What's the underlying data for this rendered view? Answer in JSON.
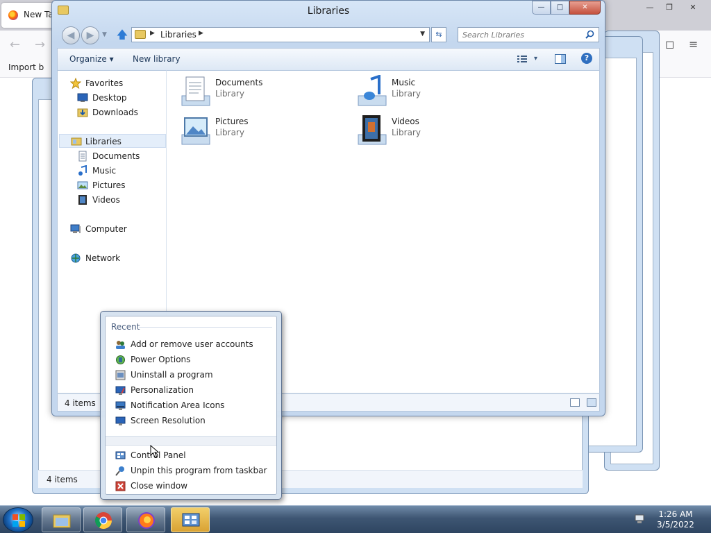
{
  "firefox": {
    "tab_label": "New Tab",
    "bookmark_import": "Import b",
    "back_glyph": "←",
    "forward_glyph": "→",
    "min_glyph": "—",
    "max_glyph": "❐",
    "close_glyph": "✕",
    "pocket_glyph": "◻",
    "menu_glyph": "≡"
  },
  "window": {
    "title": "Libraries",
    "min_glyph": "—",
    "max_glyph": "□",
    "close_glyph": "✕"
  },
  "navigation": {
    "back_glyph": "◀",
    "forward_glyph": "▶",
    "up_glyph": "🡅",
    "address_label": "Libraries",
    "address_sep": "▶",
    "dropdown_glyph": "▼",
    "refresh_glyph": "⇆",
    "search_placeholder": "Search Libraries"
  },
  "toolbar": {
    "organize_label": "Organize",
    "organize_arrow": "▾",
    "new_library_label": "New library",
    "view_arrow": "▾",
    "help_glyph": "?"
  },
  "nav_pane": {
    "favorites": {
      "label": "Favorites",
      "icon": "star-icon"
    },
    "favorites_items": [
      {
        "label": "Desktop",
        "icon": "desktop-icon"
      },
      {
        "label": "Downloads",
        "icon": "downloads-folder-icon"
      }
    ],
    "libraries": {
      "label": "Libraries",
      "icon": "libraries-icon"
    },
    "libraries_items": [
      {
        "label": "Documents",
        "icon": "documents-icon"
      },
      {
        "label": "Music",
        "icon": "music-icon"
      },
      {
        "label": "Pictures",
        "icon": "pictures-icon"
      },
      {
        "label": "Videos",
        "icon": "videos-icon"
      }
    ],
    "computer": {
      "label": "Computer",
      "icon": "computer-icon"
    },
    "network": {
      "label": "Network",
      "icon": "network-icon"
    }
  },
  "libraries": [
    {
      "name": "Documents",
      "type": "Library",
      "icon": "documents-library-icon"
    },
    {
      "name": "Music",
      "type": "Library",
      "icon": "music-library-icon"
    },
    {
      "name": "Pictures",
      "type": "Library",
      "icon": "pictures-library-icon"
    },
    {
      "name": "Videos",
      "type": "Library",
      "icon": "videos-library-icon"
    }
  ],
  "status": {
    "item_count": "4 items"
  },
  "background_window": {
    "item_count": "4 items"
  },
  "jump_list": {
    "section_title": "Recent",
    "recent": [
      {
        "label": "Add or remove user accounts",
        "icon": "user-accounts-icon"
      },
      {
        "label": "Power Options",
        "icon": "power-options-icon"
      },
      {
        "label": "Uninstall a program",
        "icon": "programs-icon"
      },
      {
        "label": "Personalization",
        "icon": "personalization-icon"
      },
      {
        "label": "Notification Area Icons",
        "icon": "notification-area-icon"
      },
      {
        "label": "Screen Resolution",
        "icon": "display-icon"
      }
    ],
    "tasks": [
      {
        "label": "Control Panel",
        "icon": "control-panel-icon"
      },
      {
        "label": "Unpin this program from taskbar",
        "icon": "unpin-icon"
      },
      {
        "label": "Close window",
        "icon": "close-window-icon"
      }
    ]
  },
  "taskbar": {
    "pinned": [
      "file-explorer-icon",
      "chrome-icon",
      "firefox-icon",
      "control-panel-icon"
    ],
    "time": "1:26 AM",
    "date": "3/5/2022"
  },
  "colors": {
    "window_frame": "#c4d7ee",
    "close_button": "#c4513e",
    "taskbar": "#3e5673",
    "active_taskbar_button": "#d9a233",
    "accent_blue": "#2c7bd6"
  }
}
